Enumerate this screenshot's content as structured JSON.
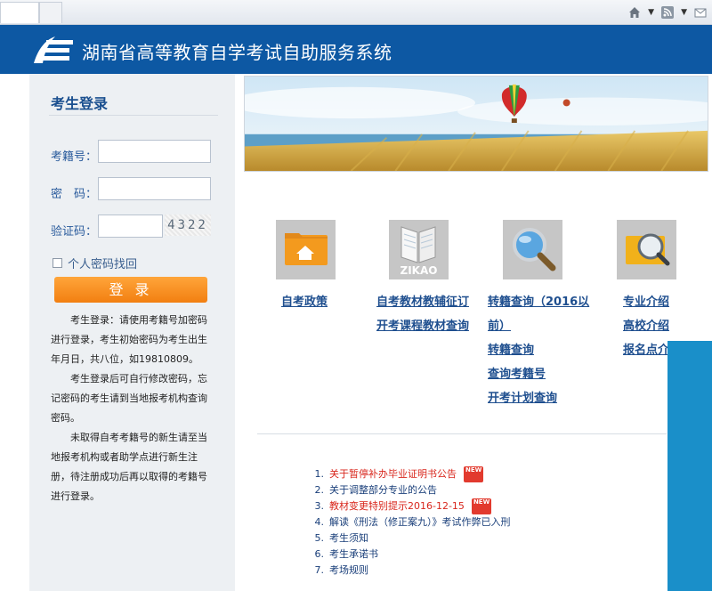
{
  "header": {
    "title": "湖南省高等教育自学考试自助服务系统"
  },
  "login": {
    "title": "考生登录",
    "id_label": "考籍号：",
    "password_label": "密　码：",
    "captcha_label": "验证码：",
    "captcha_text": "4322",
    "recover_label": "个人密码找回",
    "login_button": "登 录",
    "notes": [
      "考生登录：请使用考籍号加密码进行登录，考生初始密码为考生出生年月日，共八位，如19810809。",
      "考生登录后可自行修改密码，忘记密码的考生请到当地报考机构查询密码。",
      "未取得自考考籍号的新生请至当地报考机构或者助学点进行新生注册，待注册成功后再以取得的考籍号进行登录。"
    ]
  },
  "categories": [
    {
      "icon": "folder-home-icon",
      "links": [
        "自考政策"
      ]
    },
    {
      "icon": "zikao-book-icon",
      "icon_text": "ZIKAO",
      "links": [
        "自考教材教辅征订",
        "开考课程教材查询"
      ]
    },
    {
      "icon": "magnifier-icon",
      "links": [
        "转籍查询（2016以",
        "前）",
        "转籍查询",
        "查询考籍号",
        "开考计划查询"
      ]
    },
    {
      "icon": "search-folder-icon",
      "links": [
        "专业介绍",
        "高校介绍",
        "报名点介"
      ]
    }
  ],
  "notices": [
    {
      "num": "1.",
      "text": "关于暂停补办毕业证明书公告",
      "new": true,
      "color": "red"
    },
    {
      "num": "2.",
      "text": "关于调整部分专业的公告",
      "new": false,
      "color": "blue"
    },
    {
      "num": "3.",
      "text": "教材变更特别提示2016-12-15",
      "new": true,
      "color": "red"
    },
    {
      "num": "4.",
      "text": "解读《刑法（修正案九）》考试作弊已入刑",
      "new": false,
      "color": "blue"
    },
    {
      "num": "5.",
      "text": "考生须知",
      "new": false,
      "color": "blue"
    },
    {
      "num": "6.",
      "text": "考生承诺书",
      "new": false,
      "color": "blue"
    },
    {
      "num": "7.",
      "text": "考场规则",
      "new": false,
      "color": "blue"
    }
  ],
  "badge_text": "NEW",
  "colors": {
    "header": "#0d58a3",
    "accent_orange": "#f27f11",
    "link_blue": "#1f4f8f",
    "notice_red": "#d8261c",
    "right_bar": "#1a8fc9"
  }
}
